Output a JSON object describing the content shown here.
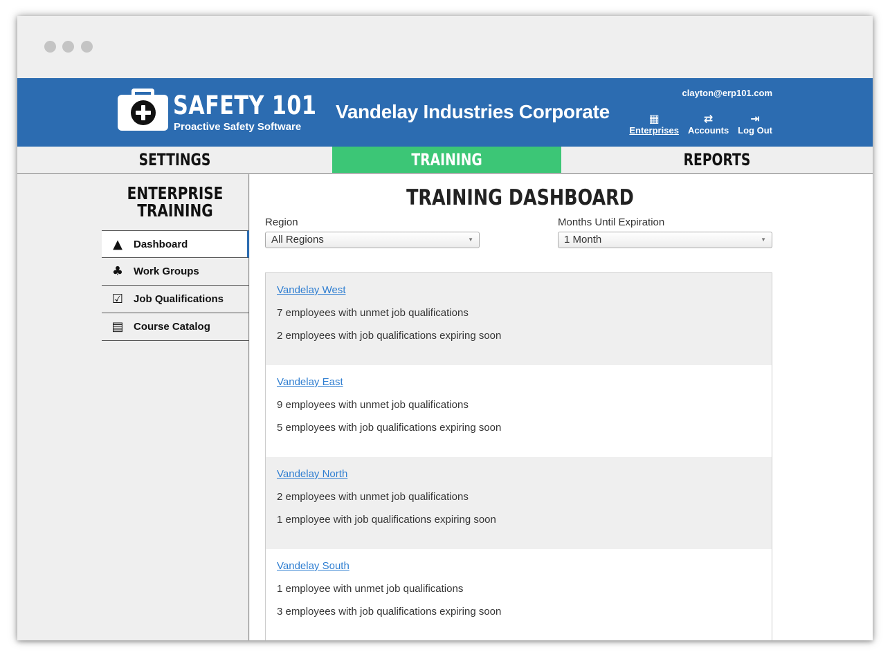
{
  "header": {
    "brand_name": "SAFETY 101",
    "brand_tagline": "Proactive Safety Software",
    "company": "Vandelay Industries Corporate",
    "user_email": "clayton@erp101.com",
    "links": [
      {
        "label": "Enterprises",
        "icon": "building-icon"
      },
      {
        "label": "Accounts",
        "icon": "swap-arrows-icon"
      },
      {
        "label": "Log Out",
        "icon": "logout-icon"
      }
    ],
    "brand_color": "#2c6cb1"
  },
  "nav": {
    "tabs": [
      {
        "label": "SETTINGS",
        "active": false
      },
      {
        "label": "TRAINING",
        "active": true
      },
      {
        "label": "REPORTS",
        "active": false
      }
    ],
    "active_color": "#3cc676"
  },
  "sidebar": {
    "title_line1": "ENTERPRISE",
    "title_line2": "TRAINING",
    "items": [
      {
        "label": "Dashboard",
        "icon": "warning-bell-icon",
        "active": true
      },
      {
        "label": "Work Groups",
        "icon": "people-group-icon",
        "active": false
      },
      {
        "label": "Job Qualifications",
        "icon": "qualification-check-icon",
        "active": false
      },
      {
        "label": "Course Catalog",
        "icon": "course-catalog-icon",
        "active": false
      }
    ]
  },
  "main": {
    "title": "TRAINING DASHBOARD",
    "region_filter": {
      "label": "Region",
      "value": "All Regions"
    },
    "months_filter": {
      "label": "Months Until Expiration",
      "value": "1 Month"
    },
    "regions": [
      {
        "name": "Vandelay West",
        "unmet": "7 employees with unmet job qualifications",
        "expiring": "2 employees with job qualifications expiring soon"
      },
      {
        "name": "Vandelay East",
        "unmet": "9 employees with unmet job qualifications",
        "expiring": "5 employees with job qualifications expiring soon"
      },
      {
        "name": "Vandelay North",
        "unmet": "2 employees with unmet job qualifications",
        "expiring": "1 employee with job qualifications expiring soon"
      },
      {
        "name": "Vandelay South",
        "unmet": "1 employee with unmet job qualifications",
        "expiring": "3 employees with job qualifications expiring soon"
      }
    ],
    "link_color": "#2f7ed1"
  }
}
